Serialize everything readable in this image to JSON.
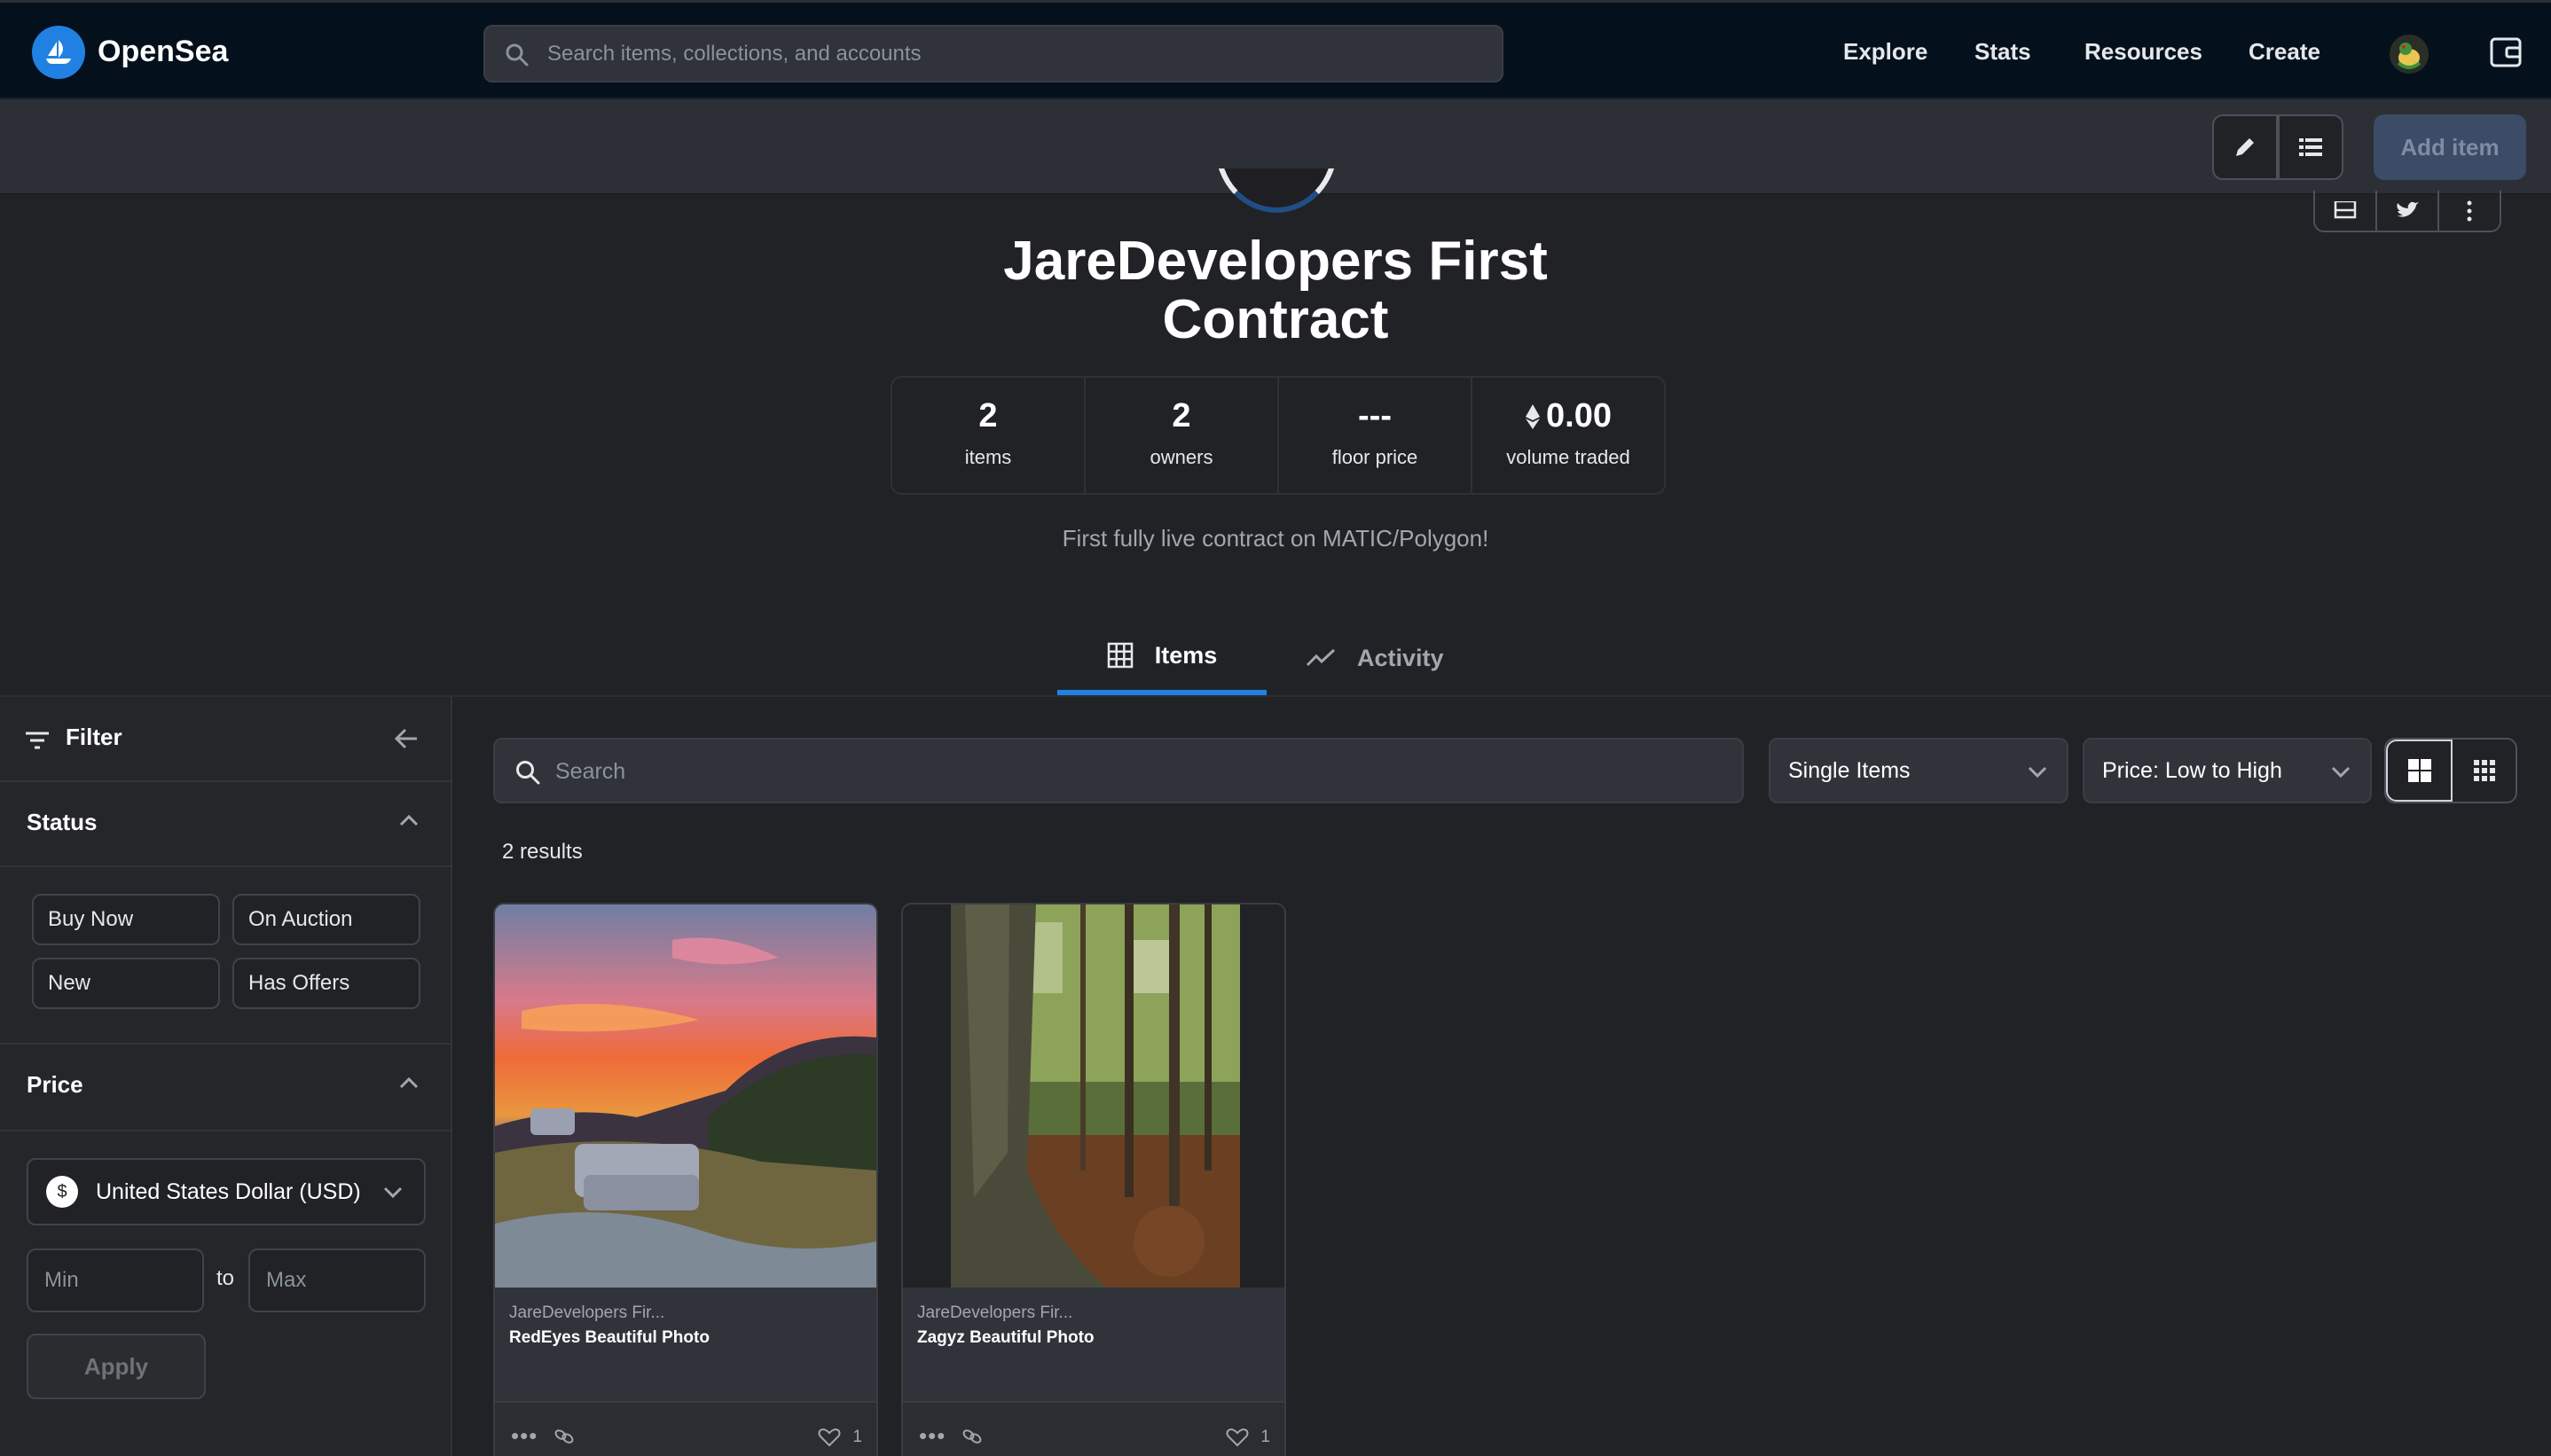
{
  "nav": {
    "brand": "OpenSea",
    "search_placeholder": "Search items, collections, and accounts",
    "links": [
      "Explore",
      "Stats",
      "Resources",
      "Create"
    ]
  },
  "toolbar": {
    "add_item": "Add item"
  },
  "collection": {
    "title": "JareDevelopers First Contract",
    "description": "First fully live contract on MATIC/Polygon!",
    "stats": [
      {
        "value": "2",
        "label": "items"
      },
      {
        "value": "2",
        "label": "owners"
      },
      {
        "value": "---",
        "label": "floor price"
      },
      {
        "value": "0.00",
        "label": "volume traded"
      }
    ]
  },
  "tabs": [
    {
      "label": "Items"
    },
    {
      "label": "Activity"
    }
  ],
  "filter": {
    "title": "Filter",
    "status": {
      "title": "Status",
      "chips": [
        "Buy Now",
        "On Auction",
        "New",
        "Has Offers"
      ]
    },
    "price": {
      "title": "Price",
      "currency": "United States Dollar (USD)",
      "currency_symbol": "$",
      "min_placeholder": "Min",
      "to": "to",
      "max_placeholder": "Max",
      "apply": "Apply"
    }
  },
  "main": {
    "search_placeholder": "Search",
    "item_type": "Single Items",
    "sort": "Price: Low to High",
    "results": "2 results",
    "cards": [
      {
        "collection": "JareDevelopers Fir...",
        "name": "RedEyes Beautiful Photo",
        "likes": "1"
      },
      {
        "collection": "JareDevelopers Fir...",
        "name": "Zagyz Beautiful Photo",
        "likes": "1"
      }
    ]
  },
  "colors": {
    "accent": "#2081e2",
    "nav_bg": "#04111d",
    "page_bg": "#202225"
  }
}
